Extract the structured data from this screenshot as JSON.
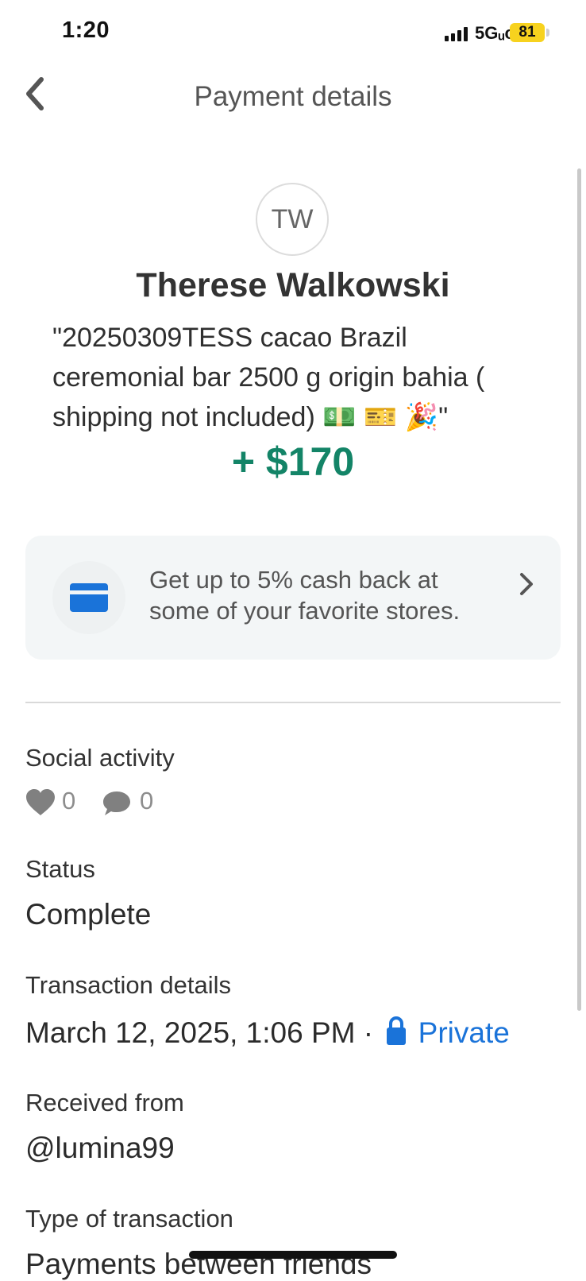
{
  "status_bar": {
    "time": "1:20",
    "network": "5Gᵤc",
    "battery": "81"
  },
  "header": {
    "title": "Payment details"
  },
  "profile": {
    "initials": "TW",
    "name": "Therese Walkowski",
    "note": "\"20250309TESS cacao Brazil ceremonial bar 2500 g origin bahia ( shipping not included) 💵 🎫 🎉\"",
    "amount": "+ $170"
  },
  "promo": {
    "text": "Get up to 5% cash back at some of your favorite stores."
  },
  "social": {
    "label": "Social activity",
    "likes": "0",
    "comments": "0"
  },
  "status": {
    "label": "Status",
    "value": "Complete"
  },
  "transaction": {
    "label": "Transaction details",
    "date": "March 12, 2025, 1:06 PM",
    "separator": "·",
    "privacy": "Private"
  },
  "received": {
    "label": "Received from",
    "value": "@lumina99"
  },
  "type": {
    "label": "Type of transaction",
    "value": "Payments between friends"
  },
  "colors": {
    "amount": "#138467",
    "link": "#1a73d9",
    "card_icon": "#1a73d9",
    "battery": "#f7d21e"
  }
}
